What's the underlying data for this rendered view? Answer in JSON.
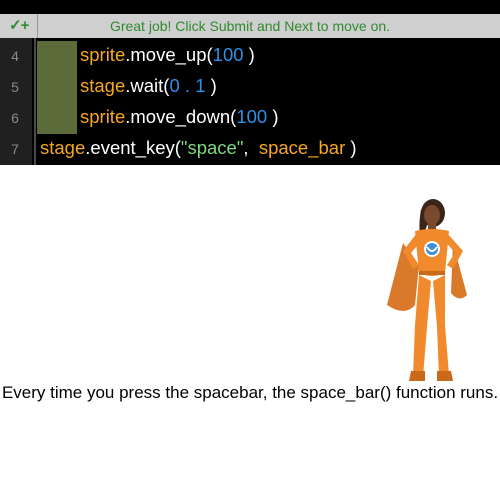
{
  "status": {
    "icon": "check-plus-icon",
    "icon_text": "✓+",
    "message": "Great job! Click Submit and Next to move on."
  },
  "code_lines": [
    {
      "num": "4",
      "indented": true,
      "tokens": [
        {
          "t": "sprite",
          "k": "obj"
        },
        {
          "t": ".move_up(",
          "k": "fn"
        },
        {
          "t": "100",
          "k": "num"
        },
        {
          "t": " )",
          "k": "fn"
        }
      ]
    },
    {
      "num": "5",
      "indented": true,
      "tokens": [
        {
          "t": "stage",
          "k": "obj"
        },
        {
          "t": ".wait(",
          "k": "fn"
        },
        {
          "t": "0",
          "k": "num"
        },
        {
          "t": " . ",
          "k": "num"
        },
        {
          "t": "1",
          "k": "num"
        },
        {
          "t": " )",
          "k": "fn"
        }
      ]
    },
    {
      "num": "6",
      "indented": true,
      "tokens": [
        {
          "t": "sprite",
          "k": "obj"
        },
        {
          "t": ".move_down(",
          "k": "fn"
        },
        {
          "t": "100",
          "k": "num"
        },
        {
          "t": " )",
          "k": "fn"
        }
      ]
    },
    {
      "num": "7",
      "indented": false,
      "tokens": [
        {
          "t": "stage",
          "k": "obj"
        },
        {
          "t": ".event_key(",
          "k": "fn"
        },
        {
          "t": "\"space\"",
          "k": "str"
        },
        {
          "t": ",  ",
          "k": "fn"
        },
        {
          "t": "space_bar",
          "k": "obj"
        },
        {
          "t": " )",
          "k": "fn"
        }
      ]
    }
  ],
  "stage": {
    "sprite": "superhero-character",
    "caption": "Every time you press the spacebar, the space_bar() function runs."
  },
  "colors": {
    "object": "#f5a623",
    "number": "#2f8fe6",
    "string": "#7ed87e",
    "indent": "#5b6b3a",
    "success_text": "#2f8a2f"
  }
}
